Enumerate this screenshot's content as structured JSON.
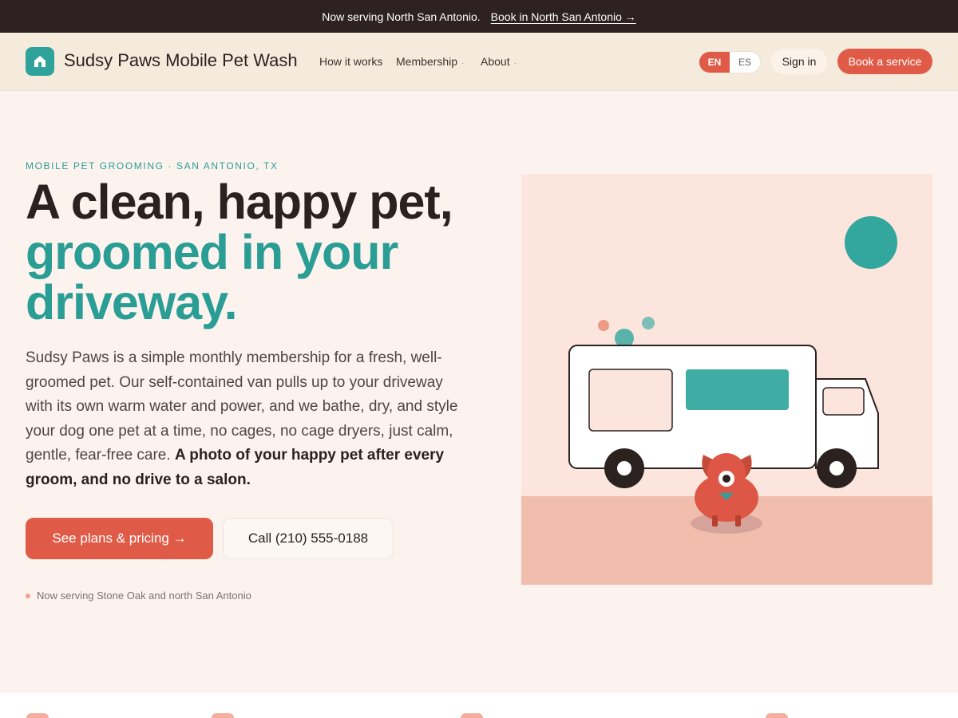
{
  "announcement": {
    "text": "Now serving North San Antonio.",
    "link": "Book in North San Antonio →"
  },
  "nav": {
    "brand": "Sudsy Paws Mobile Pet Wash",
    "logo_icon": "house-icon",
    "links": [
      {
        "label": "How it works"
      },
      {
        "label": "Membership",
        "caret": "·"
      },
      {
        "label": "About",
        "caret": "·"
      }
    ],
    "languages": [
      "EN",
      "ES"
    ],
    "active_language": "EN",
    "signin": "Sign in",
    "book": "Book a service"
  },
  "hero": {
    "eyebrow": "MOBILE PET GROOMING · SAN ANTONIO, TX",
    "title_line1": "A clean, happy pet,",
    "title_line2": "groomed in your",
    "title_line3": "driveway.",
    "body": "Sudsy Paws is a simple monthly membership for a fresh, well-groomed pet. Our self-contained van pulls up to your driveway with its own warm water and power, and we bathe, dry, and style your dog one pet at a time, no cages, no cage dryers, just calm, gentle, fear-free care.",
    "body_emphasis": "A photo of your happy pet after every groom, and no drive to a salon.",
    "cta_primary": "See plans & pricing →",
    "cta_secondary": "Call (210) 555-0188",
    "serving": "Now serving Stone Oak and north San Antonio"
  },
  "colors": {
    "accent": "#e05b47",
    "teal": "#2a9d95",
    "dark": "#2d2221",
    "background": "#fcf3ef"
  }
}
